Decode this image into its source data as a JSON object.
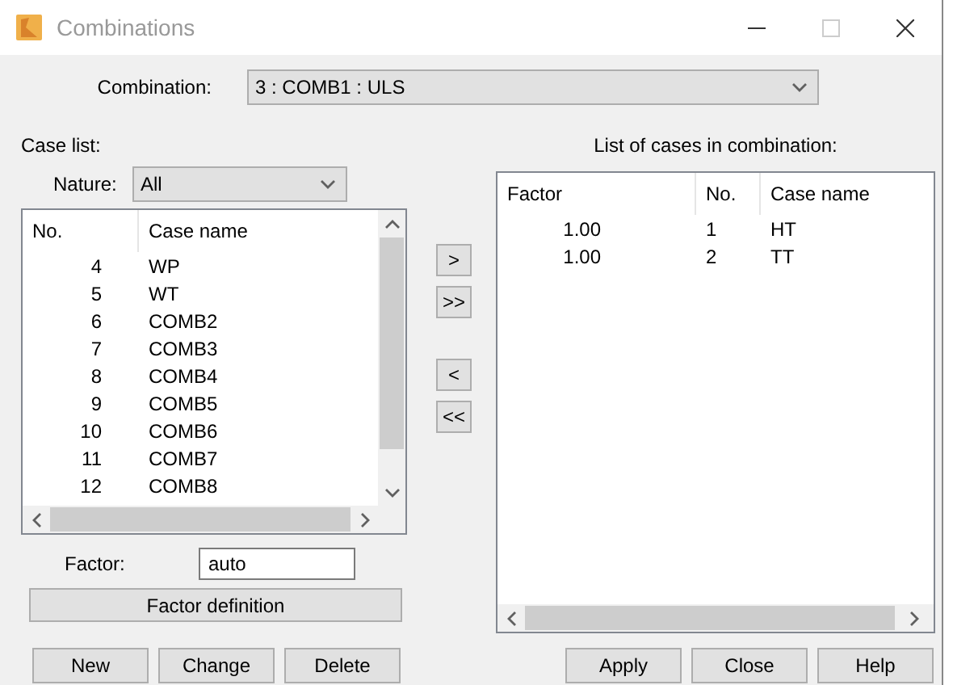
{
  "window": {
    "title": "Combinations"
  },
  "combination": {
    "label": "Combination:",
    "value": "3 : COMB1 : ULS"
  },
  "case_list": {
    "title": "Case list:",
    "nature": {
      "label": "Nature:",
      "value": "All"
    },
    "columns": [
      "No.",
      "Case name"
    ],
    "rows": [
      {
        "no": "4",
        "name": "WP"
      },
      {
        "no": "5",
        "name": "WT"
      },
      {
        "no": "6",
        "name": "COMB2"
      },
      {
        "no": "7",
        "name": "COMB3"
      },
      {
        "no": "8",
        "name": "COMB4"
      },
      {
        "no": "9",
        "name": "COMB5"
      },
      {
        "no": "10",
        "name": "COMB6"
      },
      {
        "no": "11",
        "name": "COMB7"
      },
      {
        "no": "12",
        "name": "COMB8"
      }
    ],
    "factor": {
      "label": "Factor:",
      "value": "auto"
    },
    "factor_definition_button": "Factor definition",
    "buttons": [
      "New",
      "Change",
      "Delete"
    ]
  },
  "move_buttons": [
    ">",
    ">>",
    "<",
    "<<"
  ],
  "combination_cases": {
    "title": "List of cases in combination:",
    "columns": [
      "Factor",
      "No.",
      "Case name"
    ],
    "rows": [
      {
        "factor": "1.00",
        "no": "1",
        "name": "HT"
      },
      {
        "factor": "1.00",
        "no": "2",
        "name": "TT"
      }
    ],
    "buttons": [
      "Apply",
      "Close",
      "Help"
    ]
  }
}
